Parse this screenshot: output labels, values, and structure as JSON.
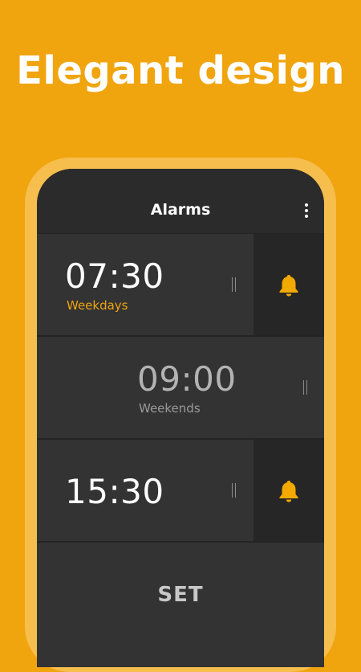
{
  "promo": {
    "headline": "Elegant design"
  },
  "app_bar": {
    "title": "Alarms",
    "menu_icon": "more-vert-icon"
  },
  "alarms": [
    {
      "time": "07:30",
      "label": "Weekdays",
      "enabled": true,
      "label_color": "#F0A40E",
      "time_color": "#ffffff",
      "bell_icon": "bell-icon"
    },
    {
      "time": "09:00",
      "label": "Weekends",
      "enabled": false,
      "label_color": "#9a9a9a",
      "time_color": "#b3b3b3"
    },
    {
      "time": "15:30",
      "label": "",
      "enabled": true,
      "time_color": "#ffffff",
      "bell_icon": "bell-icon"
    }
  ],
  "actions": {
    "set_label": "SET"
  },
  "colors": {
    "accent": "#F0A40E",
    "frame": "#F6BE4D",
    "surface": "#333333",
    "bell_panel": "#262626",
    "bell": "#F2A900"
  }
}
